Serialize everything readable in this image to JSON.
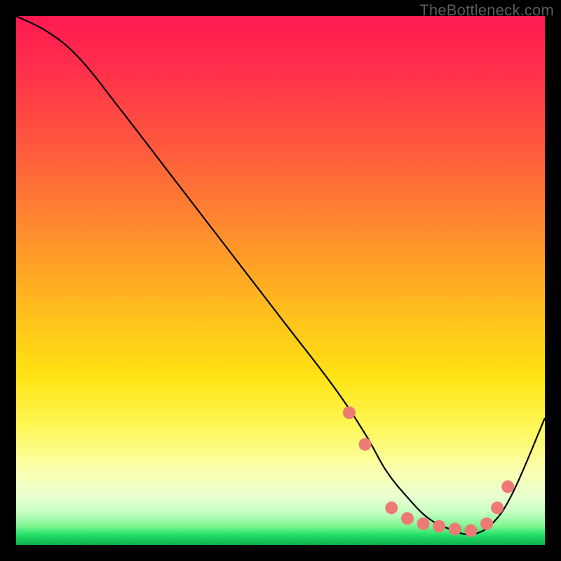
{
  "watermark": "TheBottleneck.com",
  "chart_data": {
    "type": "line",
    "title": "",
    "xlabel": "",
    "ylabel": "",
    "xlim": [
      0,
      100
    ],
    "ylim": [
      0,
      100
    ],
    "series": [
      {
        "name": "curve",
        "x": [
          0,
          6,
          12,
          20,
          30,
          40,
          50,
          60,
          66,
          70,
          74,
          78,
          82,
          86,
          90,
          94,
          100
        ],
        "values": [
          100,
          97,
          92,
          82,
          69,
          56,
          43,
          30,
          21,
          14,
          9,
          5,
          3,
          2,
          4,
          10,
          24
        ]
      }
    ],
    "markers": {
      "name": "dots",
      "x": [
        63,
        66,
        71,
        74,
        77,
        80,
        83,
        86,
        89,
        91,
        93
      ],
      "values": [
        25,
        19,
        7,
        5,
        4,
        3.5,
        3,
        2.7,
        4,
        7,
        11
      ],
      "color": "#ed7a75",
      "radius_px": 9
    },
    "curve_color": "#000000",
    "background": "rainbow-vertical-gradient"
  }
}
